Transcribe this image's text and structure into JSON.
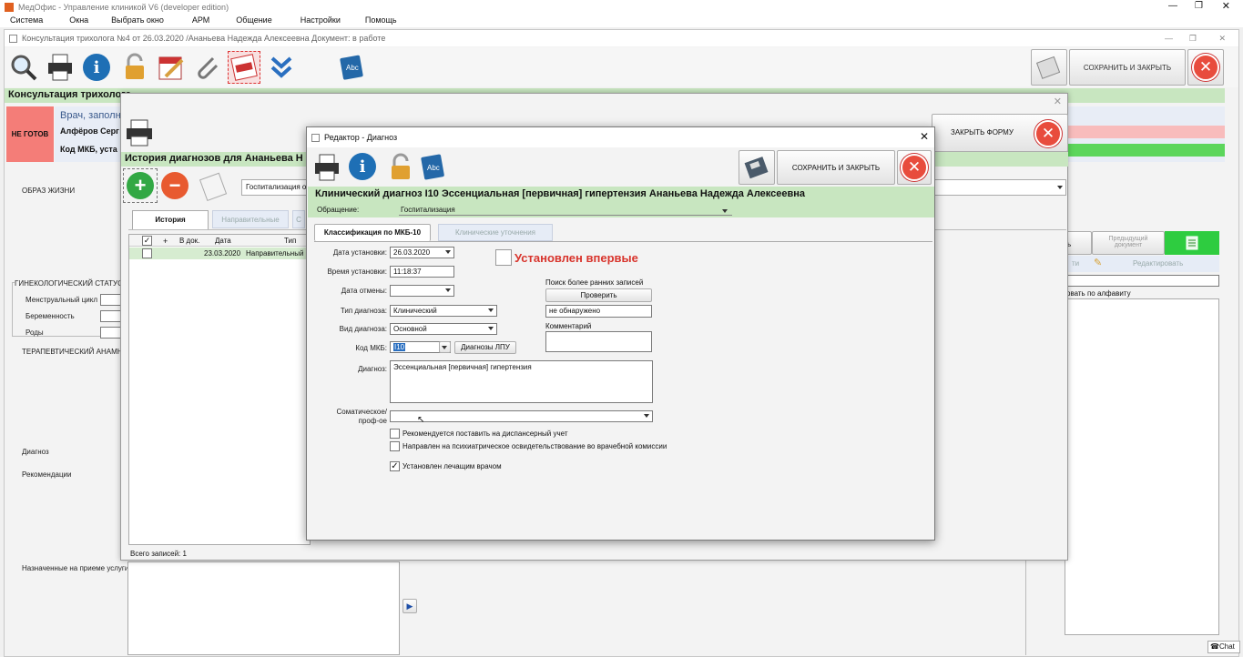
{
  "app": {
    "title": "МедОфис - Управление клиникой V6 (developer edition)",
    "menu": [
      "Система",
      "Окна",
      "Выбрать окно",
      "АРМ",
      "Общение",
      "Настройки",
      "Помощь"
    ]
  },
  "doc": {
    "title": "Консультация трихолога №4 от 26.03.2020 /Ананьева Надежда Алексеевна Документ: в работе",
    "save_close": "СОХРАНИТЬ И ЗАКРЫТЬ",
    "heading": "Консультация трихолога",
    "status": "НЕ ГОТОВ",
    "doctor_line": "Врач, заполн",
    "doctor_name": "Алфёров Серг",
    "mkb_label": "Код МКБ, уста",
    "sections": {
      "lifestyle": "ОБРАЗ ЖИЗНИ",
      "gyn": "ГИНЕКОЛОГИЧЕСКИЙ СТАТУС",
      "cycle": "Менструальный цикл",
      "pregnancy": "Беременность",
      "births": "Роды",
      "therapy": "ТЕРАПЕВТИЧЕСКИЙ АНАМНЕЗ",
      "diagnosis": "Диагноз",
      "recommendations": "Рекомендации",
      "services": "Назначенные на приеме услуги"
    },
    "right": {
      "tab_short": "ь",
      "prev_doc": "Предыдущий документ",
      "short": "ти",
      "edit": "Редактировать",
      "sort": "рвать по алфавиту"
    }
  },
  "history": {
    "close_form": "ЗАКРЫТЬ ФОРМУ",
    "heading": "История диагнозов для Ананьева Н",
    "combo": "Госпитализация от",
    "tabs": [
      "История",
      "Направительные",
      "С"
    ],
    "columns": [
      "+",
      "В док.",
      "Дата",
      "Тип"
    ],
    "rows": [
      {
        "date": "23.03.2020",
        "type": "Направительный"
      }
    ],
    "footer": "Всего записей: 1"
  },
  "editor": {
    "title": "Редактор - Диагноз",
    "save_close": "СОХРАНИТЬ И ЗАКРЫТЬ",
    "heading": "Клинический диагноз I10 Эссенциальная [первичная] гипертензия Ананьева Надежда Алексеевна",
    "appeal_label": "Обращение:",
    "appeal_value": "Госпитализация",
    "tabs": [
      "Классификация по МКБ-10",
      "Клинические уточнения"
    ],
    "labels": {
      "date_set": "Дата установки:",
      "time_set": "Время установки:",
      "date_cancel": "Дата отмены:",
      "dx_type": "Тип диагноза:",
      "dx_kind": "Вид диагноза:",
      "mkb": "Код МКБ:",
      "dx": "Диагноз:",
      "somatic": "Соматическое/ проф-ое",
      "search": "Поиск более ранних записей",
      "comment": "Комментарий"
    },
    "values": {
      "date_set": "26.03.2020",
      "time_set": "11:18:37",
      "date_cancel": "",
      "dx_type": "Клинический",
      "dx_kind": "Основной",
      "mkb": "I10",
      "dx": "Эссенциальная [первичная] гипертензия",
      "somatic": "",
      "search_result": "не обнаружено",
      "comment": ""
    },
    "first_time": "Установлен впервые",
    "check_btn": "Проверить",
    "lpu_btn": "Диагнозы ЛПУ",
    "checkboxes": [
      {
        "label": "Рекомендуется поставить на диспансерный учет",
        "checked": false
      },
      {
        "label": "Направлен на психиатрическое освидетельствование во врачебной комиссии",
        "checked": false
      },
      {
        "label": "Установлен лечащим врачом",
        "checked": true
      }
    ]
  },
  "taskbar": {
    "chat": "Chat"
  },
  "colors": {
    "green": "#c8e6c0",
    "red": "#e84c3d",
    "blue": "#1e6fb5",
    "gold": "#e0a030"
  }
}
